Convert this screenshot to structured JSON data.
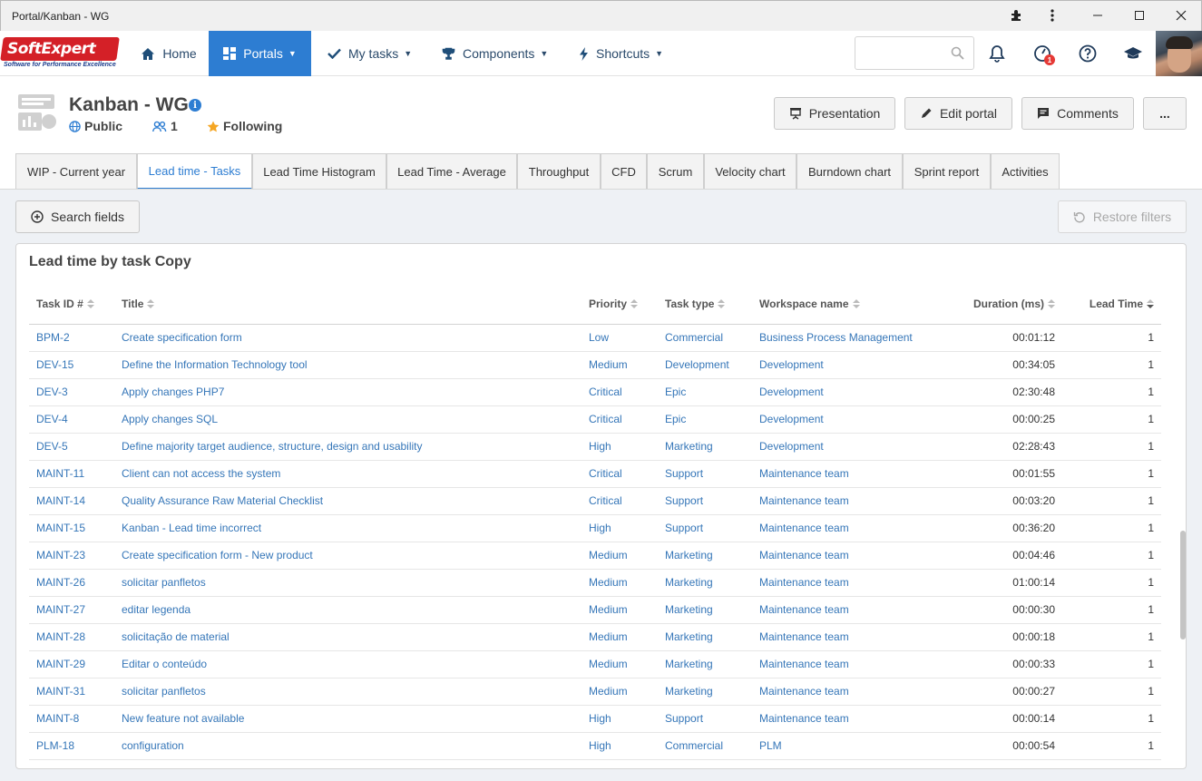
{
  "window": {
    "title": "Portal/Kanban - WG"
  },
  "logo": {
    "text": "SoftExpert",
    "tagline": "Software for Performance Excellence"
  },
  "nav": {
    "home": "Home",
    "portals": "Portals",
    "my_tasks": "My tasks",
    "components": "Components",
    "shortcuts": "Shortcuts"
  },
  "notifications": {
    "badge": "1"
  },
  "portal": {
    "title": "Kanban - WG",
    "visibility": "Public",
    "members": "1",
    "following": "Following"
  },
  "actions": {
    "presentation": "Presentation",
    "edit_portal": "Edit portal",
    "comments": "Comments",
    "more": "..."
  },
  "tabs": [
    {
      "label": "WIP - Current year"
    },
    {
      "label": "Lead time - Tasks"
    },
    {
      "label": "Lead Time Histogram"
    },
    {
      "label": "Lead Time - Average"
    },
    {
      "label": "Throughput"
    },
    {
      "label": "CFD"
    },
    {
      "label": "Scrum"
    },
    {
      "label": "Velocity chart"
    },
    {
      "label": "Burndown chart"
    },
    {
      "label": "Sprint report"
    },
    {
      "label": "Activities"
    }
  ],
  "filters": {
    "search_fields": "Search fields",
    "restore_filters": "Restore filters"
  },
  "panel": {
    "title": "Lead time by task Copy",
    "columns": [
      "Task ID #",
      "Title",
      "Priority",
      "Task type",
      "Workspace name",
      "Duration (ms)",
      "Lead Time"
    ],
    "rows": [
      [
        "BPM-2",
        "Create specification form",
        "Low",
        "Commercial",
        "Business Process Management",
        "00:01:12",
        "1"
      ],
      [
        "DEV-15",
        "Define the Information Technology tool",
        "Medium",
        "Development",
        "Development",
        "00:34:05",
        "1"
      ],
      [
        "DEV-3",
        "Apply changes PHP7",
        "Critical",
        "Epic",
        "Development",
        "02:30:48",
        "1"
      ],
      [
        "DEV-4",
        "Apply changes SQL",
        "Critical",
        "Epic",
        "Development",
        "00:00:25",
        "1"
      ],
      [
        "DEV-5",
        "Define majority target audience, structure, design and usability",
        "High",
        "Marketing",
        "Development",
        "02:28:43",
        "1"
      ],
      [
        "MAINT-11",
        "Client can not access the system",
        "Critical",
        "Support",
        "Maintenance team",
        "00:01:55",
        "1"
      ],
      [
        "MAINT-14",
        "Quality Assurance Raw Material Checklist",
        "Critical",
        "Support",
        "Maintenance team",
        "00:03:20",
        "1"
      ],
      [
        "MAINT-15",
        "Kanban - Lead time incorrect",
        "High",
        "Support",
        "Maintenance team",
        "00:36:20",
        "1"
      ],
      [
        "MAINT-23",
        "Create specification form - New product",
        "Medium",
        "Marketing",
        "Maintenance team",
        "00:04:46",
        "1"
      ],
      [
        "MAINT-26",
        "solicitar panfletos",
        "Medium",
        "Marketing",
        "Maintenance team",
        "01:00:14",
        "1"
      ],
      [
        "MAINT-27",
        "editar legenda",
        "Medium",
        "Marketing",
        "Maintenance team",
        "00:00:30",
        "1"
      ],
      [
        "MAINT-28",
        "solicitação de material",
        "Medium",
        "Marketing",
        "Maintenance team",
        "00:00:18",
        "1"
      ],
      [
        "MAINT-29",
        "Editar o conteúdo",
        "Medium",
        "Marketing",
        "Maintenance team",
        "00:00:33",
        "1"
      ],
      [
        "MAINT-31",
        "solicitar panfletos",
        "Medium",
        "Marketing",
        "Maintenance team",
        "00:00:27",
        "1"
      ],
      [
        "MAINT-8",
        "New feature not available",
        "High",
        "Support",
        "Maintenance team",
        "00:00:14",
        "1"
      ],
      [
        "PLM-18",
        "configuration",
        "High",
        "Commercial",
        "PLM",
        "00:00:54",
        "1"
      ]
    ]
  }
}
